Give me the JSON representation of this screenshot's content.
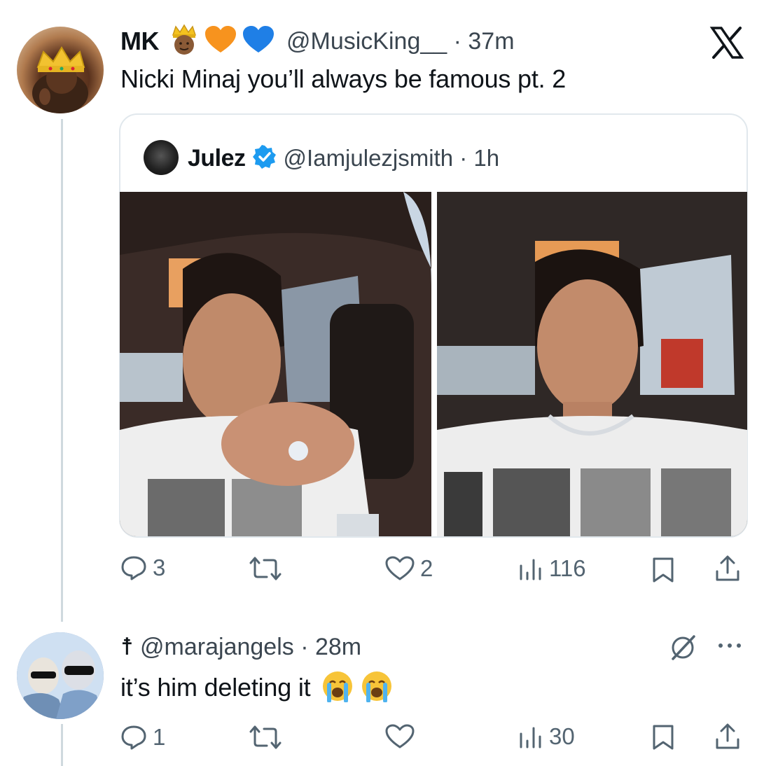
{
  "tweet": {
    "author_name": "MK",
    "author_badges": [
      "crown-face-emoji",
      "orange-heart-emoji",
      "blue-heart-emoji"
    ],
    "handle_time": "@MusicKing__ · 37m",
    "text": "Nicki Minaj you’ll always be famous pt. 2",
    "quote": {
      "author_name": "Julez",
      "verified": true,
      "handle_time": "@Iamjulezjsmith · 1h",
      "images": [
        "selfie-in-car-showing-ring",
        "selfie-in-car"
      ]
    },
    "actions": {
      "replies": "3",
      "retweets": "",
      "likes": "2",
      "views": "116"
    }
  },
  "reply": {
    "name_glyph": "☨",
    "handle_time": "@marajangels · 28m",
    "text": "it’s him deleting it",
    "emojis": [
      "loudly-crying-face",
      "loudly-crying-face"
    ],
    "actions": {
      "replies": "1",
      "retweets": "",
      "likes": "",
      "views": "30"
    }
  },
  "colors": {
    "text": "#0f1419",
    "secondary": "#536471",
    "verified": "#1d9bf0",
    "border": "#e1e8ed",
    "thread_line": "#cfd9de"
  }
}
